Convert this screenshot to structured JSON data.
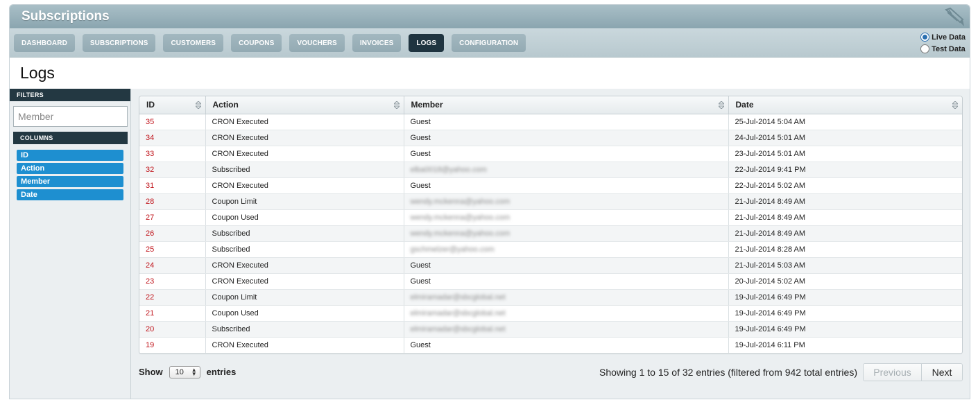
{
  "app": {
    "title": "Subscriptions",
    "brand_icon": "pen-nib-icon"
  },
  "nav": {
    "tabs": [
      {
        "label": "DASHBOARD",
        "active": false
      },
      {
        "label": "SUBSCRIPTIONS",
        "active": false
      },
      {
        "label": "CUSTOMERS",
        "active": false
      },
      {
        "label": "COUPONS",
        "active": false
      },
      {
        "label": "VOUCHERS",
        "active": false
      },
      {
        "label": "INVOICES",
        "active": false
      },
      {
        "label": "LOGS",
        "active": true
      },
      {
        "label": "CONFIGURATION",
        "active": false
      }
    ],
    "data_mode": [
      {
        "label": "Live Data",
        "selected": true
      },
      {
        "label": "Test Data",
        "selected": false
      }
    ]
  },
  "page": {
    "title": "Logs"
  },
  "sidebar": {
    "filters_heading": "FILTERS",
    "member_placeholder": "Member",
    "columns_heading": "COLUMNS",
    "columns": [
      "ID",
      "Action",
      "Member",
      "Date"
    ]
  },
  "table": {
    "headers": [
      "ID",
      "Action",
      "Member",
      "Date"
    ],
    "rows": [
      {
        "id": "35",
        "action": "CRON Executed",
        "member": "Guest",
        "blurred": false,
        "date": "25-Jul-2014 5:04 AM"
      },
      {
        "id": "34",
        "action": "CRON Executed",
        "member": "Guest",
        "blurred": false,
        "date": "24-Jul-2014 5:01 AM"
      },
      {
        "id": "33",
        "action": "CRON Executed",
        "member": "Guest",
        "blurred": false,
        "date": "23-Jul-2014 5:01 AM"
      },
      {
        "id": "32",
        "action": "Subscribed",
        "member": "elba0018@yahoo.com",
        "blurred": true,
        "date": "22-Jul-2014 9:41 PM"
      },
      {
        "id": "31",
        "action": "CRON Executed",
        "member": "Guest",
        "blurred": false,
        "date": "22-Jul-2014 5:02 AM"
      },
      {
        "id": "28",
        "action": "Coupon Limit",
        "member": "wendy.mckenna@yahoo.com",
        "blurred": true,
        "date": "21-Jul-2014 8:49 AM"
      },
      {
        "id": "27",
        "action": "Coupon Used",
        "member": "wendy.mckenna@yahoo.com",
        "blurred": true,
        "date": "21-Jul-2014 8:49 AM"
      },
      {
        "id": "26",
        "action": "Subscribed",
        "member": "wendy.mckenna@yahoo.com",
        "blurred": true,
        "date": "21-Jul-2014 8:49 AM"
      },
      {
        "id": "25",
        "action": "Subscribed",
        "member": "gschmelzer@yahoo.com",
        "blurred": true,
        "date": "21-Jul-2014 8:28 AM"
      },
      {
        "id": "24",
        "action": "CRON Executed",
        "member": "Guest",
        "blurred": false,
        "date": "21-Jul-2014 5:03 AM"
      },
      {
        "id": "23",
        "action": "CRON Executed",
        "member": "Guest",
        "blurred": false,
        "date": "20-Jul-2014 5:02 AM"
      },
      {
        "id": "22",
        "action": "Coupon Limit",
        "member": "elmiramadar@sbcglobal.net",
        "blurred": true,
        "date": "19-Jul-2014 6:49 PM"
      },
      {
        "id": "21",
        "action": "Coupon Used",
        "member": "elmiramadar@sbcglobal.net",
        "blurred": true,
        "date": "19-Jul-2014 6:49 PM"
      },
      {
        "id": "20",
        "action": "Subscribed",
        "member": "elmiramadar@sbcglobal.net",
        "blurred": true,
        "date": "19-Jul-2014 6:49 PM"
      },
      {
        "id": "19",
        "action": "CRON Executed",
        "member": "Guest",
        "blurred": false,
        "date": "19-Jul-2014 6:11 PM"
      }
    ]
  },
  "footer": {
    "show_label": "Show",
    "page_length": "10",
    "entries_label": "entries",
    "info": "Showing 1 to 15 of 32 entries (filtered from 942 total entries)",
    "previous_label": "Previous",
    "next_label": "Next"
  }
}
